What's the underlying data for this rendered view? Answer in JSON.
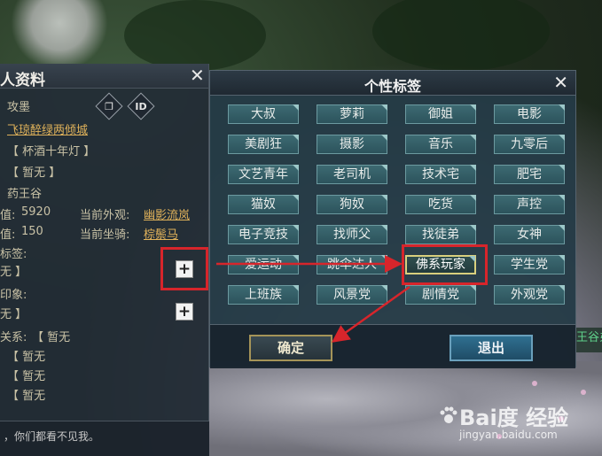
{
  "profile_panel": {
    "title": "人资料",
    "close_icon": "✕",
    "name": "攻墨",
    "copy_icon": "copy-icon",
    "id_button": "ID",
    "guild_link": "飞琼醉绿两倾城",
    "title_tag": "【 杯酒十年灯 】",
    "spouse_tag": "【 暂无 】",
    "school": "药王谷",
    "stat1_label": "值:",
    "stat1_value": "5920",
    "appearance_label": "当前外观:",
    "appearance_link": "幽影流岚",
    "stat2_label": "值:",
    "stat2_value": "150",
    "mount_label": "当前坐骑:",
    "mount_link": "棕鬃马",
    "tags_label": "标签:",
    "tags_value": "无 】",
    "impression_label": "印象:",
    "impression_value": "无 】",
    "relation_label": "关系:",
    "relation_value": "【 暂无",
    "extra_rows": [
      "【 暂无",
      "【 暂无",
      "【 暂无"
    ],
    "footer_text": "，你们都看不见我。",
    "plus_symbol": "+"
  },
  "tag_dialog": {
    "title": "个性标签",
    "close_icon": "✕",
    "tags": [
      "大叔",
      "萝莉",
      "御姐",
      "电影",
      "美剧狂",
      "摄影",
      "音乐",
      "九零后",
      "文艺青年",
      "老司机",
      "技术宅",
      "肥宅",
      "猫奴",
      "狗奴",
      "吃货",
      "声控",
      "电子竞技",
      "找师父",
      "找徒弟",
      "女神",
      "爱运动",
      "跳伞达人",
      "佛系玩家",
      "学生党",
      "上班族",
      "风景党",
      "剧情党",
      "外观党"
    ],
    "selected_tag": "佛系玩家",
    "ok_button": "确定",
    "exit_button": "退出"
  },
  "side_strip_text": "王谷弟",
  "watermark": {
    "main": "Bai度 经验",
    "sub": "jingyan.baidu.com"
  },
  "colors": {
    "annotation_red": "#d7252b",
    "link_gold": "#e0b25a",
    "tag_teal": "#3d6a72",
    "exit_blue": "#2f6f90"
  }
}
